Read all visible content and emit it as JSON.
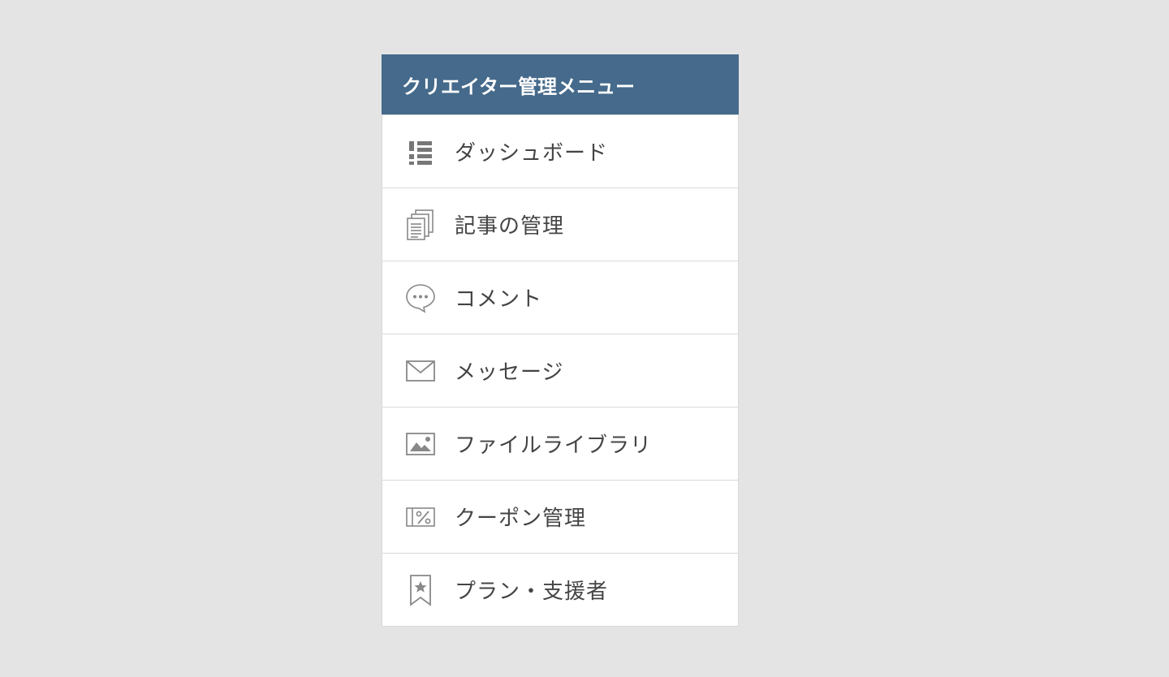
{
  "menu": {
    "title": "クリエイター管理メニュー",
    "header_color": "#456a8b",
    "items": [
      {
        "label": "ダッシュボード",
        "icon": "dashboard-list-icon"
      },
      {
        "label": "記事の管理",
        "icon": "documents-icon"
      },
      {
        "label": "コメント",
        "icon": "speech-bubble-icon"
      },
      {
        "label": "メッセージ",
        "icon": "envelope-icon"
      },
      {
        "label": "ファイルライブラリ",
        "icon": "image-icon"
      },
      {
        "label": "クーポン管理",
        "icon": "coupon-percent-icon"
      },
      {
        "label": "プラン・支援者",
        "icon": "bookmark-star-icon"
      }
    ]
  }
}
